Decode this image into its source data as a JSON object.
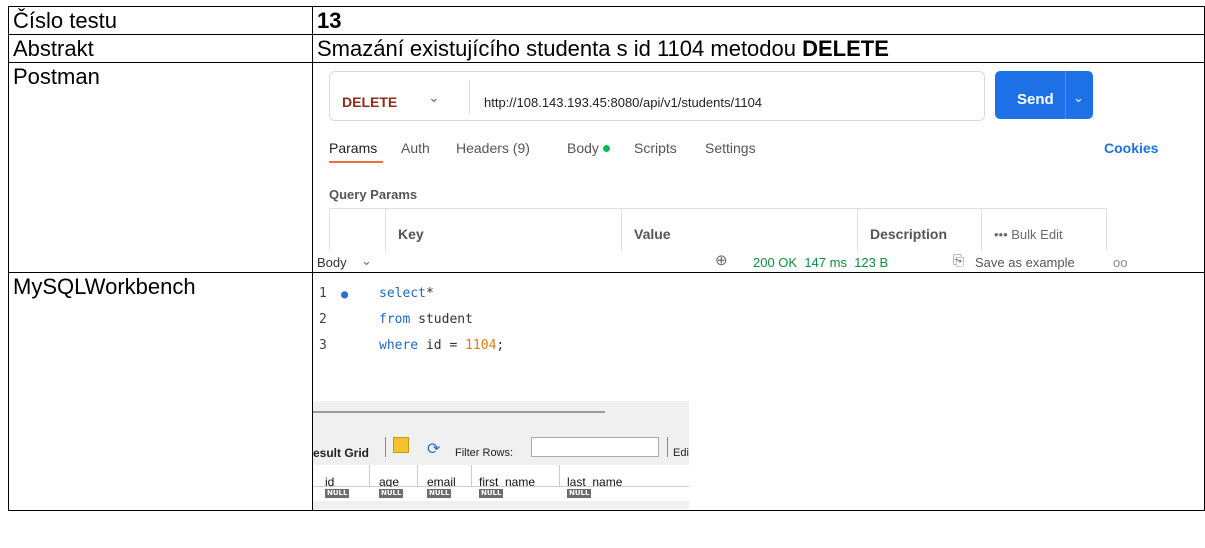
{
  "rows": {
    "test_number": {
      "label": "Číslo testu",
      "value": "13"
    },
    "abstract": {
      "label": "Abstrakt",
      "value_prefix": "Smazání existujícího studenta s id 1104 metodou ",
      "value_bold": "DELETE"
    },
    "postman_label": "Postman",
    "workbench_label": "MySQLWorkbench"
  },
  "postman": {
    "method": "DELETE",
    "url": "http://108.143.193.45:8080/api/v1/students/1104",
    "send_label": "Send",
    "tabs": [
      "Params",
      "Auth",
      "Headers (9)",
      "Body",
      "Scripts",
      "Settings"
    ],
    "active_tab": "Params",
    "cookies_label": "Cookies",
    "query_params_title": "Query Params",
    "columns": {
      "key": "Key",
      "value": "Value",
      "description": "Description"
    },
    "bulk_edit": "Bulk Edit",
    "response": {
      "body_label": "Body",
      "status": "200 OK",
      "time": "147 ms",
      "size": "123 B",
      "save_example": "Save as example",
      "more": "oo"
    },
    "colors": {
      "send": "#1d70e6",
      "method": "#8f2b1c",
      "status": "#0a8f3c",
      "tab_underline": "#f26b3a"
    }
  },
  "workbench": {
    "lines": [
      {
        "num": "1",
        "kw": "select",
        "rest": "*"
      },
      {
        "num": "2",
        "kw": "from",
        "rest": " student"
      },
      {
        "num": "3",
        "kw": "where",
        "rest": " id = ",
        "numval": "1104",
        "tail": ";"
      }
    ],
    "result_grid_label": "esult Grid",
    "filter_rows_label": "Filter Rows:",
    "edit_label": "Edi",
    "columns": [
      "id",
      "age",
      "email",
      "first_name",
      "last_name"
    ],
    "null_label": "NULL"
  }
}
